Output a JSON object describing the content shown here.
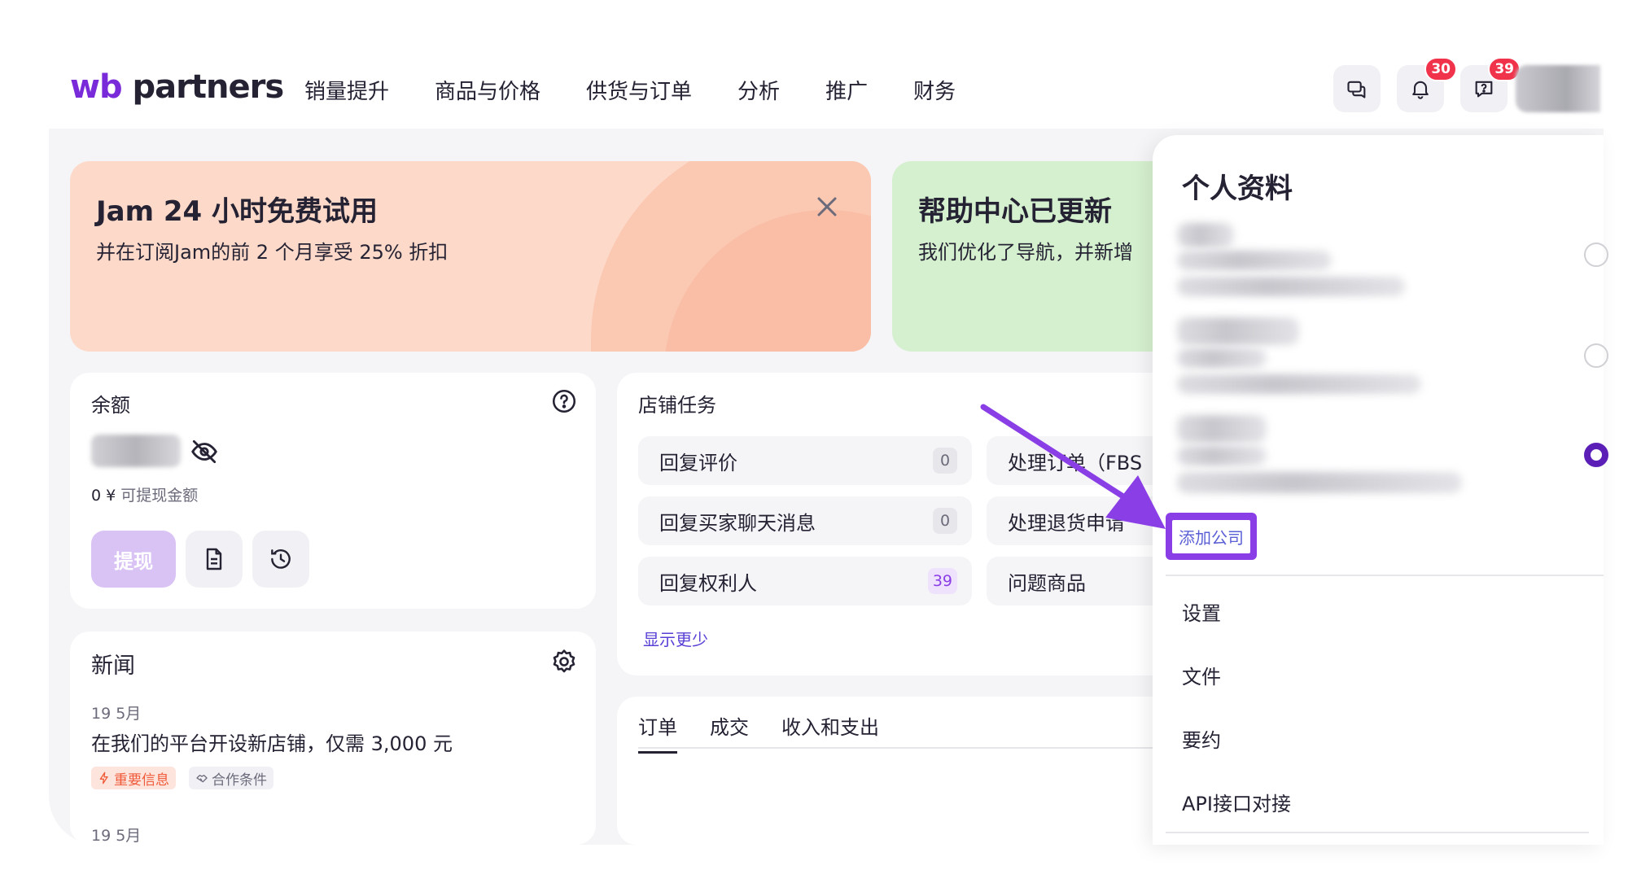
{
  "header": {
    "logo_prefix": "wb",
    "logo_suffix": "partners",
    "nav": [
      "销量提升",
      "商品与价格",
      "供货与订单",
      "分析",
      "推广",
      "财务"
    ],
    "notifications_count": "30",
    "messages_count": "39"
  },
  "promos": {
    "jam": {
      "title": "Jam 24 小时免费试用",
      "subtitle": "并在订阅Jam的前 2 个月享受 25% 折扣"
    },
    "help": {
      "title": "帮助中心已更新",
      "subtitle": "我们优化了导航，并新增"
    }
  },
  "balance": {
    "title": "余额",
    "withdrawable_amount": "0 ¥",
    "withdrawable_label": "可提现金额",
    "withdraw_label": "提现"
  },
  "tasks": {
    "title": "店铺任务",
    "items": [
      {
        "label": "回复评价",
        "count": "0"
      },
      {
        "label": "回复买家聊天消息",
        "count": "0"
      },
      {
        "label": "回复权利人",
        "count": "39"
      },
      {
        "label": "处理订单（FBS"
      },
      {
        "label": "处理退货申请"
      },
      {
        "label": "问题商品"
      }
    ],
    "show_less": "显示更少"
  },
  "news": {
    "title": "新闻",
    "items": [
      {
        "date": "19 5月",
        "headline": "在我们的平台开设新店铺，仅需 3,000 元"
      },
      {
        "date": "19 5月"
      }
    ],
    "tags": [
      "重要信息",
      "合作条件"
    ]
  },
  "orders": {
    "tabs": [
      "订单",
      "成交",
      "收入和支出"
    ]
  },
  "profile": {
    "title": "个人资料",
    "add_company": "添加公司",
    "menu": [
      "设置",
      "文件",
      "要约",
      "API接口对接"
    ]
  },
  "colors": {
    "brand": "#7a2bd9",
    "badge": "#f0334b",
    "promo_jam": "#fdd9c9",
    "promo_help": "#d5f0ce",
    "annotation": "#8a3ee6"
  }
}
